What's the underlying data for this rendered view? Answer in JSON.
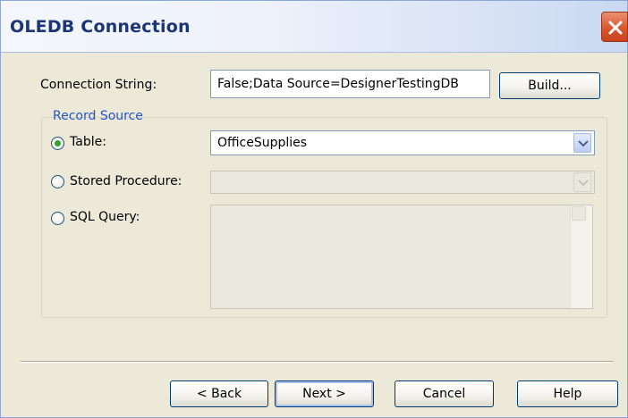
{
  "window": {
    "title": "OLEDB Connection",
    "accent_color": "#1c3578",
    "close_color": "#d6542d"
  },
  "connection": {
    "label": "Connection String:",
    "value": "False;Data Source=DesignerTestingDB",
    "build_label": "Build..."
  },
  "record_source": {
    "title": "Record Source",
    "title_color": "#2454c8",
    "options": [
      {
        "label": "Table:",
        "selected": true
      },
      {
        "label": "Stored Procedure:",
        "selected": false
      },
      {
        "label": "SQL Query:",
        "selected": false
      }
    ],
    "table_value": "OfficeSupplies",
    "stored_procedure_value": "",
    "sql_query_value": ""
  },
  "buttons": {
    "back": "< Back",
    "next": "Next >",
    "cancel": "Cancel",
    "help": "Help"
  },
  "icons": {
    "close": "close-icon",
    "dropdown": "chevron-down-icon",
    "radio": "radio-icon"
  }
}
